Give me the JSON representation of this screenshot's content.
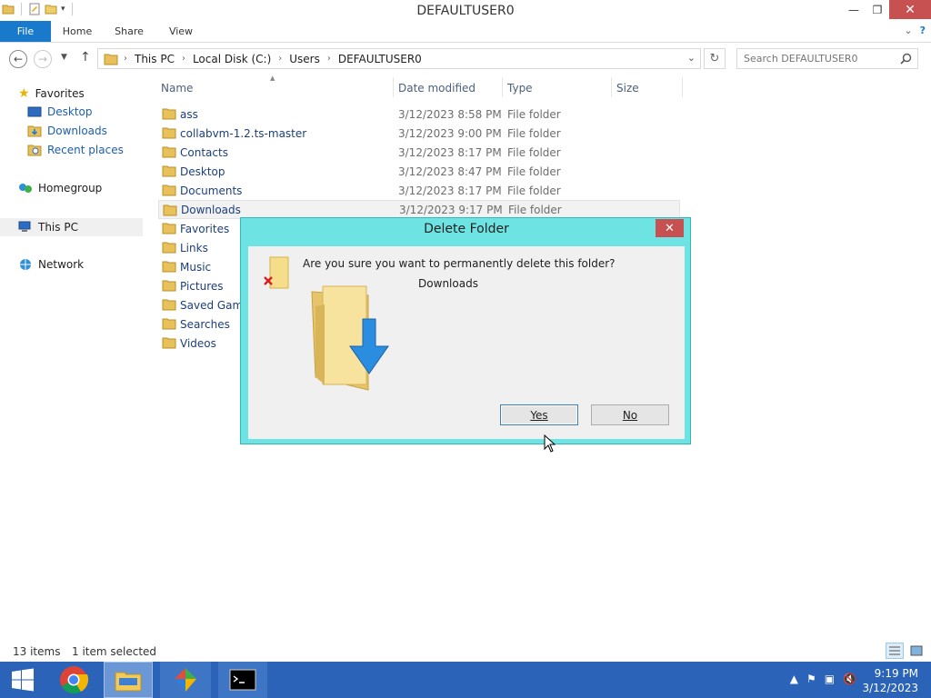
{
  "window": {
    "title": "DEFAULTUSER0",
    "minimize": "—",
    "restore": "❐",
    "close": "✕"
  },
  "ribbon": {
    "tabs": [
      "File",
      "Home",
      "Share",
      "View"
    ],
    "collapse_icon": "⌄",
    "help_icon": "?"
  },
  "address": {
    "crumbs": [
      "This PC",
      "Local Disk (C:)",
      "Users",
      "DEFAULTUSER0"
    ],
    "separator": "›"
  },
  "search": {
    "placeholder": "Search DEFAULTUSER0"
  },
  "nav": {
    "favorites": "Favorites",
    "desktop": "Desktop",
    "downloads": "Downloads",
    "recent": "Recent places",
    "homegroup": "Homegroup",
    "thispc": "This PC",
    "network": "Network"
  },
  "columns": {
    "name": "Name",
    "date": "Date modified",
    "type": "Type",
    "size": "Size"
  },
  "files": [
    {
      "name": "ass",
      "date": "3/12/2023 8:58 PM",
      "type": "File folder"
    },
    {
      "name": "collabvm-1.2.ts-master",
      "date": "3/12/2023 9:00 PM",
      "type": "File folder"
    },
    {
      "name": "Contacts",
      "date": "3/12/2023 8:17 PM",
      "type": "File folder"
    },
    {
      "name": "Desktop",
      "date": "3/12/2023 8:47 PM",
      "type": "File folder"
    },
    {
      "name": "Documents",
      "date": "3/12/2023 8:17 PM",
      "type": "File folder"
    },
    {
      "name": "Downloads",
      "date": "3/12/2023 9:17 PM",
      "type": "File folder"
    },
    {
      "name": "Favorites",
      "date": "",
      "type": ""
    },
    {
      "name": "Links",
      "date": "",
      "type": ""
    },
    {
      "name": "Music",
      "date": "",
      "type": ""
    },
    {
      "name": "Pictures",
      "date": "",
      "type": ""
    },
    {
      "name": "Saved Game",
      "date": "",
      "type": ""
    },
    {
      "name": "Searches",
      "date": "",
      "type": ""
    },
    {
      "name": "Videos",
      "date": "",
      "type": ""
    }
  ],
  "dialog": {
    "title": "Delete Folder",
    "question": "Are you sure you want to permanently delete this folder?",
    "folder": "Downloads",
    "yes": "Yes",
    "no": "No",
    "close": "✕"
  },
  "status": {
    "items": "13 items",
    "selected": "1 item selected"
  },
  "clock": {
    "time": "9:19 PM",
    "date": "3/12/2023"
  },
  "colors": {
    "accent": "#1979ca",
    "taskbar": "#2a63b8",
    "dialog_frame": "#6ee3e3",
    "close": "#c75050"
  }
}
